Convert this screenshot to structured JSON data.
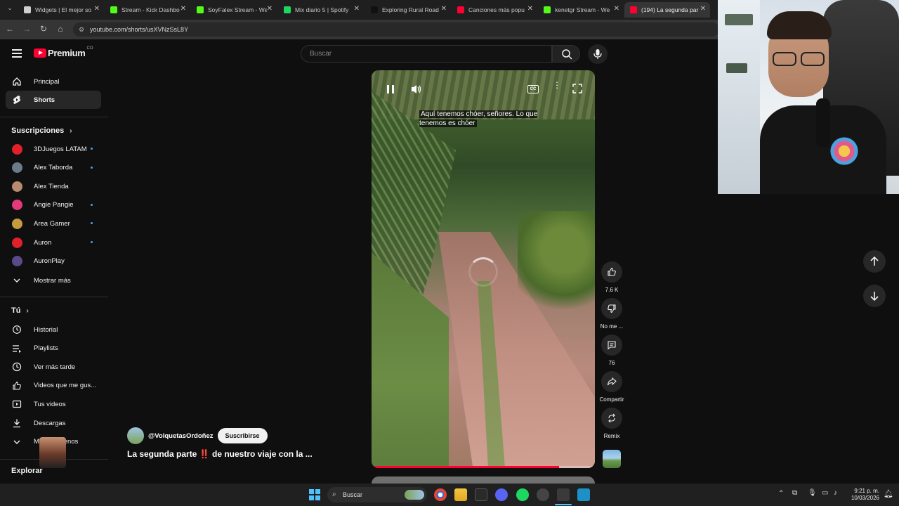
{
  "browser": {
    "tabs": [
      {
        "title": "Widgets | El mejor so",
        "favicon_color": "#cfcfcf"
      },
      {
        "title": "Stream - Kick Dashbo",
        "favicon_color": "#53fc18"
      },
      {
        "title": "SoyFalex Stream - We",
        "favicon_color": "#53fc18"
      },
      {
        "title": "Mix diario 5 | Spotify",
        "favicon_color": "#1ed760"
      },
      {
        "title": "Exploring Rural Road",
        "favicon_color": "#111111"
      },
      {
        "title": "Canciones más popu",
        "favicon_color": "#ff0033"
      },
      {
        "title": "kenetgr Stream - We",
        "favicon_color": "#53fc18"
      },
      {
        "title": "(194) La segunda par",
        "favicon_color": "#ff0033"
      }
    ],
    "url": "youtube.com/shorts/usXVNzSsL8Y"
  },
  "header": {
    "logo_text": "Premium",
    "logo_region": "CO",
    "search_placeholder": "Buscar"
  },
  "sidebar": {
    "main": [
      {
        "label": "Principal",
        "icon": "home-icon"
      },
      {
        "label": "Shorts",
        "icon": "shorts-icon",
        "active": true
      }
    ],
    "subscriptions_title": "Suscripciones",
    "subscriptions": [
      {
        "label": "3DJuegos LATAM",
        "color": "#e0202a",
        "live": true
      },
      {
        "label": "Alex Taborda",
        "color": "#6a7c8a",
        "live": true
      },
      {
        "label": "Alex Tienda",
        "color": "#b88a70",
        "live": false
      },
      {
        "label": "Angie Pangie",
        "color": "#e23a7a",
        "live": true
      },
      {
        "label": "Area Gamer",
        "color": "#c89a40",
        "live": true
      },
      {
        "label": "Auron",
        "color": "#e0202a",
        "live": true
      },
      {
        "label": "AuronPlay",
        "color": "#5a4a8a",
        "live": false
      }
    ],
    "show_more": "Mostrar más",
    "you_title": "Tú",
    "you": [
      {
        "label": "Historial",
        "icon": "history-icon"
      },
      {
        "label": "Playlists",
        "icon": "playlist-icon"
      },
      {
        "label": "Ver más tarde",
        "icon": "watch-later-icon"
      },
      {
        "label": "Videos que me gus...",
        "icon": "like-icon"
      },
      {
        "label": "Tus videos",
        "icon": "your-videos-icon"
      },
      {
        "label": "Descargas",
        "icon": "download-icon"
      },
      {
        "label": "Mostrar menos",
        "icon": "chevron-up-icon"
      }
    ],
    "explore_title": "Explorar"
  },
  "video": {
    "subtitle": "Aquí tenemos chóer, señores. Lo que tenemos es chóer",
    "progress": 0.84,
    "channel": "@VolquetasOrdoñez",
    "subscribe_label": "Suscribirse",
    "title_part1": "La segunda parte",
    "title_emoji": "‼️",
    "title_part2": "de nuestro viaje con la ..."
  },
  "actions": {
    "like_count": "7.6 K",
    "dislike_label": "No me ...",
    "comments_count": "76",
    "share_label": "Compartir",
    "remix_label": "Remix"
  },
  "taskbar": {
    "search_label": "Buscar",
    "time": "9:21 p. m.",
    "date": "10/03/2026"
  }
}
